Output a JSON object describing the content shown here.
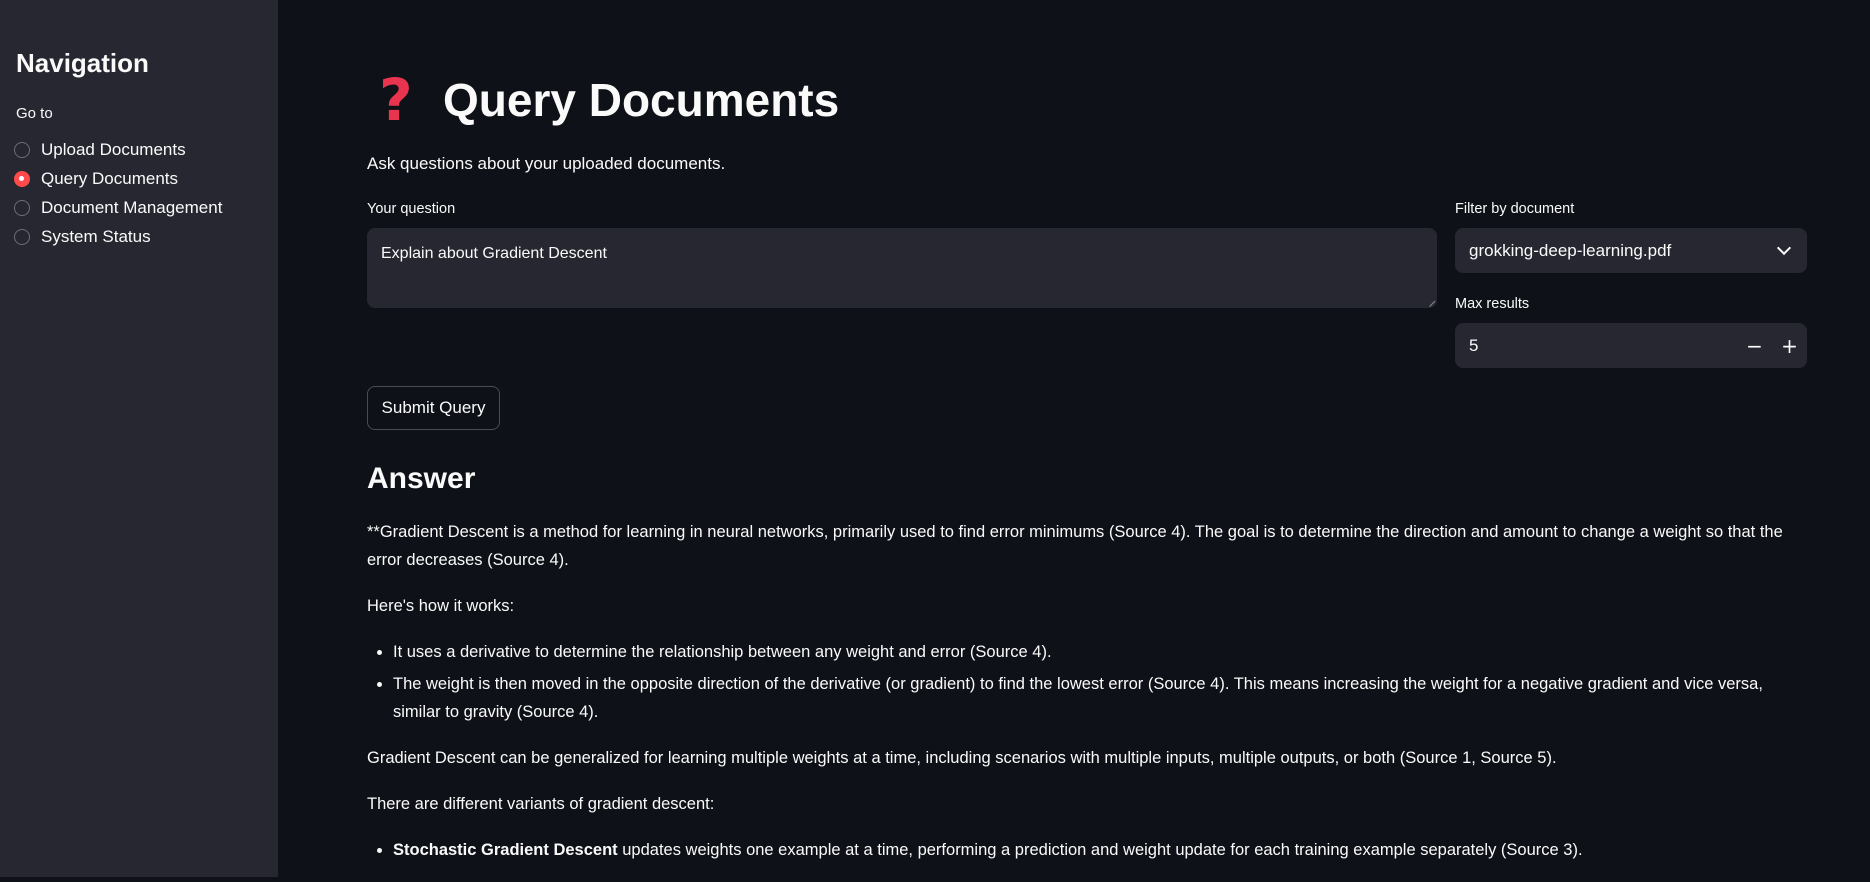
{
  "sidebar": {
    "title": "Navigation",
    "goto_label": "Go to",
    "items": [
      {
        "label": "Upload Documents",
        "selected": false
      },
      {
        "label": "Query Documents",
        "selected": true
      },
      {
        "label": "Document Management",
        "selected": false
      },
      {
        "label": "System Status",
        "selected": false
      }
    ]
  },
  "main": {
    "title_icon": "question-mark-icon",
    "title": "Query Documents",
    "subtitle": "Ask questions about your uploaded documents.",
    "question_label": "Your question",
    "question_value": "Explain about Gradient Descent",
    "filter_label": "Filter by document",
    "filter_value": "grokking-deep-learning.pdf",
    "max_results_label": "Max results",
    "max_results_value": "5",
    "minus_label": "−",
    "plus_label": "+",
    "submit_label": "Submit Query",
    "answer_heading": "Answer",
    "answer": {
      "p1": "**Gradient Descent is a method for learning in neural networks, primarily used to find error minimums (Source 4). The goal is to determine the direction and amount to change a weight so that the error decreases (Source 4).",
      "p2": "Here's how it works:",
      "bullets1": [
        "It uses a derivative to determine the relationship between any weight and error (Source 4).",
        "The weight is then moved in the opposite direction of the derivative (or gradient) to find the lowest error (Source 4). This means increasing the weight for a negative gradient and vice versa, similar to gravity (Source 4)."
      ],
      "p3": "Gradient Descent can be generalized for learning multiple weights at a time, including scenarios with multiple inputs, multiple outputs, or both (Source 1, Source 5).",
      "p4": "There are different variants of gradient descent:",
      "bullets2": [
        {
          "bold": "Stochastic Gradient Descent",
          "rest": " updates weights one example at a time, performing a prediction and weight update for each training example separately (Source 3)."
        }
      ]
    }
  },
  "colors": {
    "accent": "#ff4b4b",
    "background": "#0e1117",
    "sidebar": "#262730",
    "input": "#262730"
  }
}
